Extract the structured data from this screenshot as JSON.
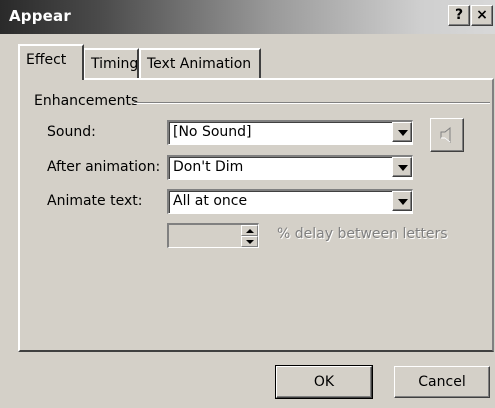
{
  "window": {
    "title": "Appear",
    "help_label": "?",
    "close_label": "×"
  },
  "tabs": [
    {
      "label": "Effect",
      "active": true
    },
    {
      "label": "Timing",
      "active": false
    },
    {
      "label": "Text Animation",
      "active": false
    }
  ],
  "enhancements": {
    "group_label": "Enhancements",
    "sound": {
      "label": "Sound:",
      "value": "[No Sound]"
    },
    "after_animation": {
      "label": "After animation:",
      "value": "Don't Dim"
    },
    "animate_text": {
      "label": "Animate text:",
      "value": "All at once"
    },
    "delay": {
      "value": "",
      "label": "% delay between letters",
      "enabled": false
    }
  },
  "icons": {
    "speaker": "speaker-icon",
    "dropdown": "chevron-down-icon"
  },
  "buttons": {
    "ok": "OK",
    "cancel": "Cancel"
  }
}
